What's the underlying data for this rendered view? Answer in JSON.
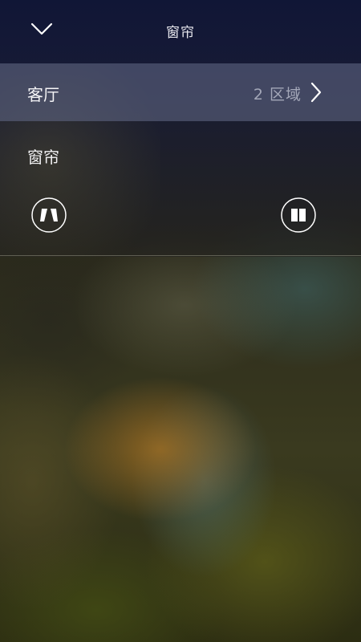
{
  "header": {
    "title": "窗帘",
    "back_icon": "chevron-down-icon"
  },
  "zone_selector": {
    "room_name": "客厅",
    "zone_count": "2 区域",
    "chevron_icon": "chevron-right-icon"
  },
  "curtain_control": {
    "label": "窗帘",
    "open_icon": "curtain-open-icon",
    "close_icon": "curtain-close-icon"
  },
  "colors": {
    "header_bg": "#101637",
    "zone_row_bg": "#5f6682",
    "zone_count_text": "#a3a7b8",
    "icon_stroke": "#ffffff"
  }
}
